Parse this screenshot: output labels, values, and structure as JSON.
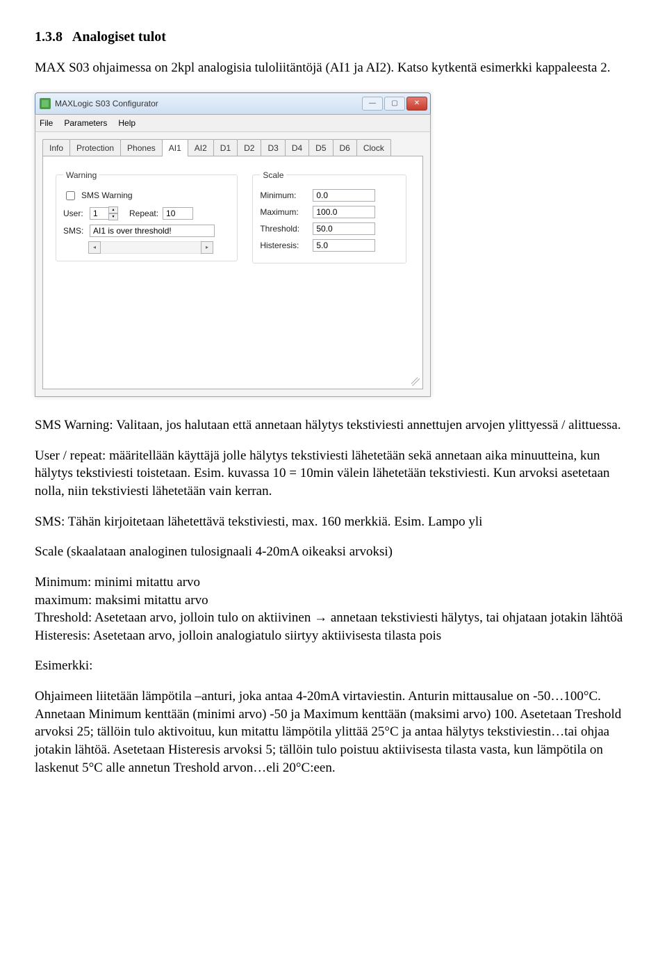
{
  "section_number": "1.3.8",
  "section_title": "Analogiset tulot",
  "intro_p1": "MAX S03 ohjaimessa on 2kpl analogisia tuloliitäntöjä (AI1 ja AI2). Katso kytkentä esimerkki kappaleesta 2.",
  "window": {
    "title": "MAXLogic S03 Configurator",
    "min_label": "—",
    "max_label": "▢",
    "close_label": "✕",
    "menu": {
      "file": "File",
      "parameters": "Parameters",
      "help": "Help"
    },
    "tabs": [
      "Info",
      "Protection",
      "Phones",
      "AI1",
      "AI2",
      "D1",
      "D2",
      "D3",
      "D4",
      "D5",
      "D6",
      "Clock"
    ],
    "active_tab": "AI1",
    "warning": {
      "legend": "Warning",
      "sms_warning_label": "SMS Warning",
      "sms_warning_checked": false,
      "user_label": "User:",
      "user_value": "1",
      "repeat_label": "Repeat:",
      "repeat_value": "10",
      "sms_label": "SMS:",
      "sms_value": "AI1 is over threshold!",
      "scroll_left": "◂",
      "scroll_right": "▸"
    },
    "scale": {
      "legend": "Scale",
      "minimum_label": "Minimum:",
      "minimum_value": "0.0",
      "maximum_label": "Maximum:",
      "maximum_value": "100.0",
      "threshold_label": "Threshold:",
      "threshold_value": "50.0",
      "histeresis_label": "Histeresis:",
      "histeresis_value": "5.0"
    }
  },
  "body": {
    "p_sms_warning": "SMS Warning: Valitaan, jos halutaan että annetaan hälytys tekstiviesti annettujen arvojen ylittyessä / alittuessa.",
    "p_user_repeat": "User / repeat: määritellään käyttäjä jolle hälytys tekstiviesti lähetetään sekä annetaan aika minuutteina, kun hälytys tekstiviesti toistetaan. Esim. kuvassa 10 = 10min välein lähetetään tekstiviesti. Kun arvoksi asetetaan nolla, niin tekstiviesti lähetetään vain kerran.",
    "p_sms": "SMS: Tähän kirjoitetaan lähetettävä tekstiviesti, max. 160 merkkiä. Esim. Lampo yli",
    "p_scale": "Scale (skaalataan analoginen tulosignaali 4-20mA oikeaksi arvoksi)",
    "p_min": "Minimum: minimi mitattu arvo",
    "p_max": "maximum: maksimi mitattu arvo",
    "p_threshold": "Threshold: Asetetaan arvo, jolloin tulo on aktiivinen → annetaan tekstiviesti hälytys, tai ohjataan jotakin lähtöä",
    "p_histeresis": "Histeresis: Asetetaan arvo, jolloin analogiatulo siirtyy aktiivisesta tilasta pois",
    "p_example_h": "Esimerkki:",
    "p_example_body": "Ohjaimeen liitetään lämpötila –anturi, joka antaa 4-20mA virtaviestin. Anturin mittausalue on -50…100°C.  Annetaan Minimum kenttään (minimi arvo) -50 ja Maximum kenttään (maksimi arvo) 100.  Asetetaan Treshold arvoksi 25; tällöin tulo aktivoituu, kun mitattu lämpötila ylittää 25°C ja antaa hälytys tekstiviestin…tai ohjaa jotakin lähtöä. Asetetaan Histeresis arvoksi 5; tällöin tulo poistuu aktiivisesta tilasta vasta, kun lämpötila on laskenut 5°C alle annetun Treshold arvon…eli 20°C:een."
  }
}
